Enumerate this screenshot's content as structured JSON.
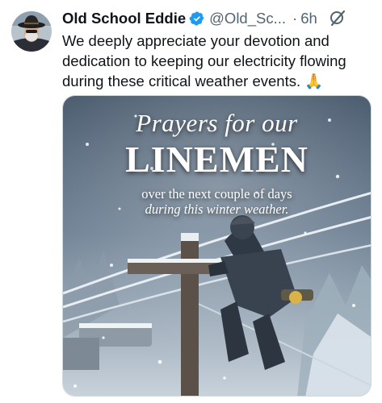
{
  "tweet": {
    "display_name": "Old School Eddie",
    "handle": "@Old_Sc...",
    "separator": "·",
    "time": "6h",
    "text_lines": [
      "We deeply appreciate your devotion and",
      "dedication to keeping our electricity flowing",
      "during these critical weather events. 🙏"
    ],
    "icons": {
      "verified": "verified-badge-icon",
      "grok": "grok-icon"
    },
    "colors": {
      "verified": "#1d9bf0",
      "name": "#0f1419",
      "secondary": "#536471"
    }
  },
  "media": {
    "line1": "Prayers for our",
    "line2": "LINEMEN",
    "line3": "over the next couple of days",
    "line4": "during this winter weather."
  }
}
